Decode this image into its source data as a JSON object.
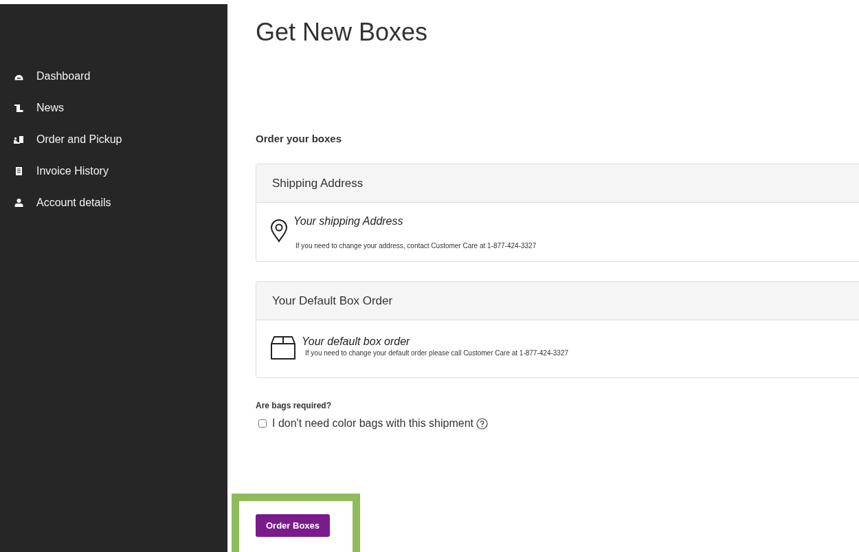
{
  "sidebar": {
    "items": [
      {
        "label": "Dashboard"
      },
      {
        "label": "News"
      },
      {
        "label": "Order and Pickup"
      },
      {
        "label": "Invoice History"
      },
      {
        "label": "Account details"
      }
    ]
  },
  "page": {
    "title": "Get New Boxes",
    "section_title": "Order your boxes"
  },
  "panels": [
    {
      "kind": "address",
      "header": "Shipping Address",
      "title": "Your shipping Address",
      "note": "If you need to change your address, contact Customer Care at 1-877-424-3327"
    },
    {
      "kind": "box",
      "header": "Your Default Box Order",
      "title": "Your default box order",
      "note": "If you need to change your default order please call Customer Care at 1-877-424-3327"
    }
  ],
  "bags": {
    "question": "Are bags required?",
    "option": {
      "label": "I don't need color bags with this shipment",
      "checked": false
    }
  },
  "submit": {
    "label": "Order Boxes"
  }
}
